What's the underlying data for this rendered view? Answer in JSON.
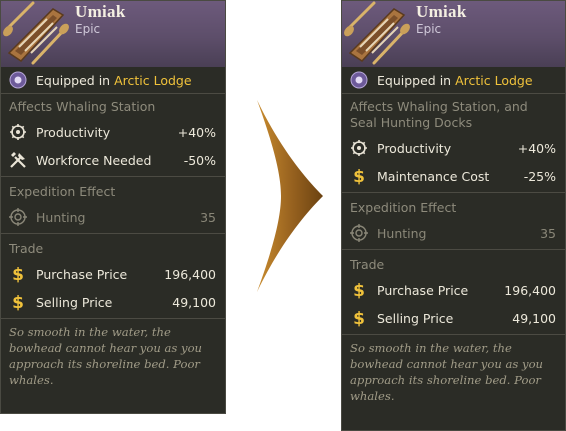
{
  "left_card": {
    "title": "Umiak",
    "rarity": "Epic",
    "equipped_prefix": "Equipped in",
    "equipped_location": "Arctic Lodge",
    "affects": "Affects Whaling Station",
    "stats": [
      {
        "icon": "gear-icon",
        "label": "Productivity",
        "value": "+40%"
      },
      {
        "icon": "tools-icon",
        "label": "Workforce Needed",
        "value": "-50%"
      }
    ],
    "expedition_title": "Expedition Effect",
    "expedition": {
      "icon": "target-icon",
      "label": "Hunting",
      "value": "35"
    },
    "trade_title": "Trade",
    "trade": [
      {
        "icon": "dollar-icon",
        "label": "Purchase Price",
        "value": "196,400"
      },
      {
        "icon": "dollar-icon",
        "label": "Selling Price",
        "value": "49,100"
      }
    ],
    "flavor": "So smooth in the water, the bowhead cannot hear you as you approach its shoreline bed. Poor whales."
  },
  "right_card": {
    "title": "Umiak",
    "rarity": "Epic",
    "equipped_prefix": "Equipped in",
    "equipped_location": "Arctic Lodge",
    "affects": "Affects Whaling Station, and Seal Hunting Docks",
    "stats": [
      {
        "icon": "gear-icon",
        "label": "Productivity",
        "value": "+40%"
      },
      {
        "icon": "dollar-icon",
        "label": "Maintenance Cost",
        "value": "-25%"
      }
    ],
    "expedition_title": "Expedition Effect",
    "expedition": {
      "icon": "target-icon",
      "label": "Hunting",
      "value": "35"
    },
    "trade_title": "Trade",
    "trade": [
      {
        "icon": "dollar-icon",
        "label": "Purchase Price",
        "value": "196,400"
      },
      {
        "icon": "dollar-icon",
        "label": "Selling Price",
        "value": "49,100"
      }
    ],
    "flavor": "So smooth in the water, the bowhead cannot hear you as you approach its shoreline bed. Poor whales."
  },
  "colors": {
    "card_bg": "#2b2c26",
    "header": "#5d4e6a",
    "gold": "#f0c23b",
    "arrow": "#9a6a24"
  }
}
